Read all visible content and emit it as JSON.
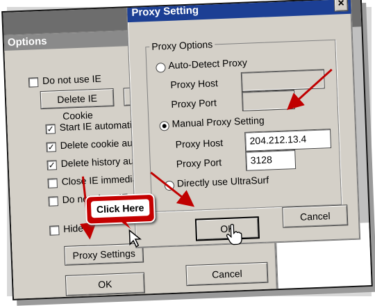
{
  "options_window": {
    "title": "Options",
    "checkboxes": [
      {
        "label": "Do not use IE",
        "checked": false
      },
      {
        "label": "Start IE automatically",
        "checked": true
      },
      {
        "label": "Delete cookie autom",
        "checked": true
      },
      {
        "label": "Delete history autom",
        "checked": true
      },
      {
        "label": "Close IE immediately",
        "checked": false
      },
      {
        "label": "Do not close IE on ex",
        "checked": false
      },
      {
        "label": "Hide G",
        "checked": false
      }
    ],
    "delete_cookie_label": "Delete IE Cookie",
    "partial_button_label": "D",
    "proxy_settings_label": "Proxy Settings",
    "ok_label": "OK",
    "cancel_label": "Cancel"
  },
  "proxy_window": {
    "title": "Proxy Setting",
    "group_title": "Proxy Options",
    "auto_detect_label": "Auto-Detect Proxy",
    "manual_label": "Manual Proxy Setting",
    "direct_label": "Directly use UltraSurf",
    "selected": "manual",
    "auto_host_label": "Proxy Host",
    "auto_port_label": "Proxy Port",
    "manual_host_label": "Proxy Host",
    "manual_port_label": "Proxy Port",
    "manual_host_value": "204.212.13.4",
    "manual_port_value": "3128",
    "ok_label": "OK",
    "cancel_label": "Cancel",
    "close_glyph": "×"
  },
  "callout": {
    "text": "Click Here"
  },
  "colors": {
    "title_active": "#1c3f94",
    "title_inactive": "#8a8a8a",
    "arrow": "#c00000",
    "dialog_face": "#d4d0c8"
  }
}
